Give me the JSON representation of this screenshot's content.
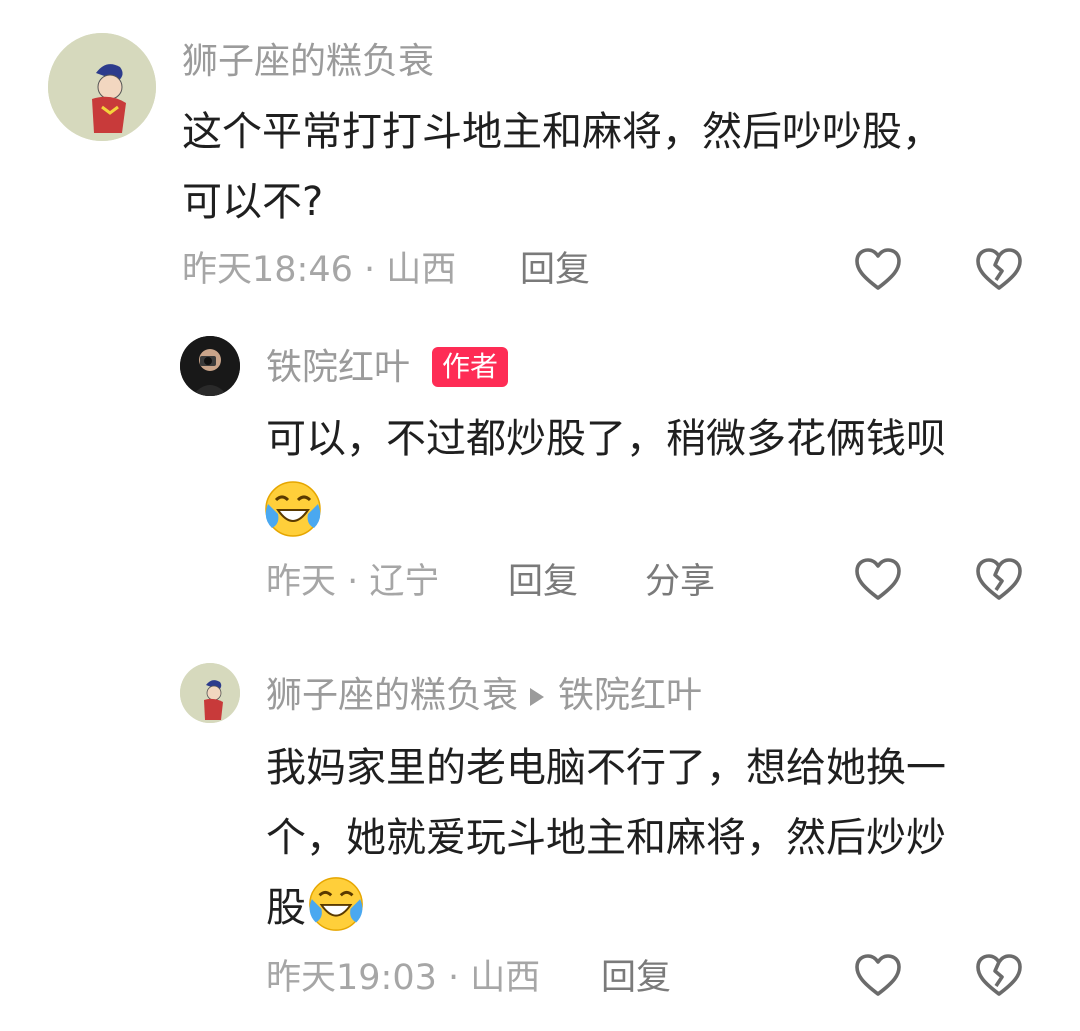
{
  "comments": [
    {
      "author": "狮子座的糕负衰",
      "text": "这个平常打打斗地主和麻将，然后吵吵股，可以不?",
      "time_location": "昨天18:46 · 山西",
      "reply_label": "回复"
    },
    {
      "author": "铁院红叶",
      "author_badge": "作者",
      "text": "可以，不过都炒股了，稍微多花俩钱呗",
      "emoji": "cry-laughing-emoji",
      "time_location": "昨天 · 辽宁",
      "reply_label": "回复",
      "share_label": "分享"
    },
    {
      "author": "狮子座的糕负衰",
      "reply_to": "铁院红叶",
      "text_line1": "我妈家里的老电脑不行了，想给她换一",
      "text_line2": "个，她就爱玩斗地主和麻将，然后炒炒",
      "text_line3": "股",
      "emoji": "cry-laughing-emoji",
      "time_location": "昨天19:03 · 山西",
      "reply_label": "回复"
    }
  ],
  "icons": {
    "like": "heart-outline-icon",
    "dislike": "broken-heart-outline-icon"
  },
  "colors": {
    "badge_bg": "#fe2c55",
    "name_text": "#9b9b9b",
    "body_text": "#1f1f1f",
    "meta_text": "#a6a6a6"
  }
}
